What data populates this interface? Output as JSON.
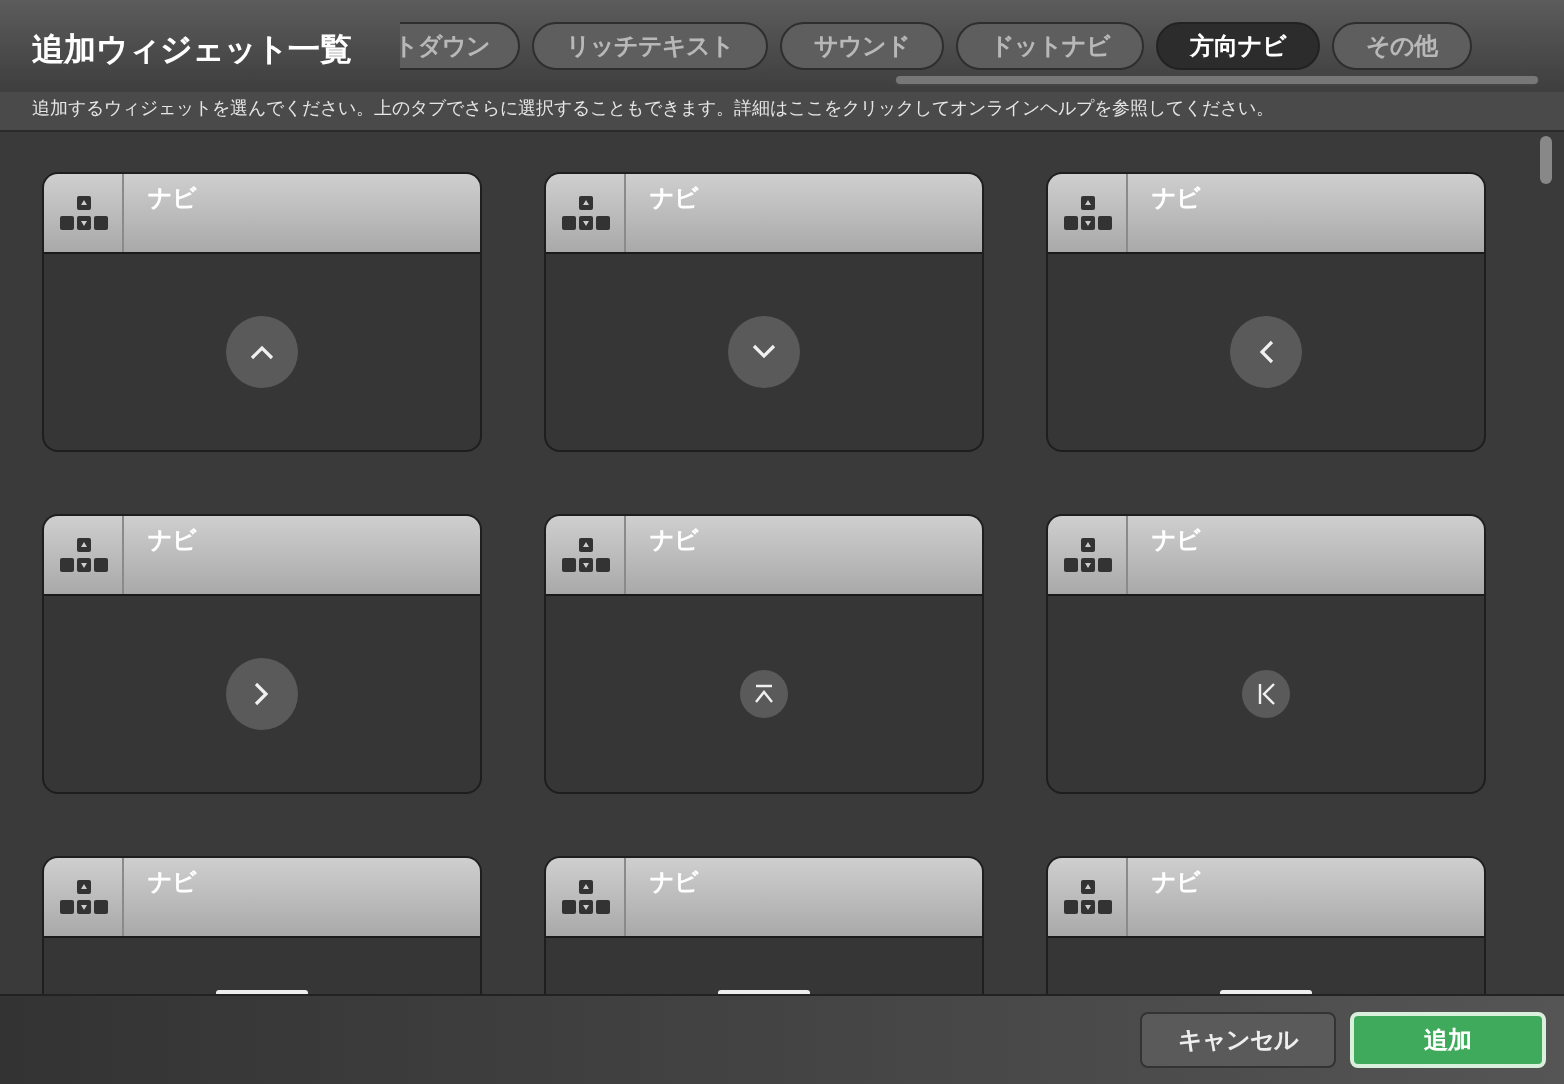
{
  "window": {
    "title": "追加ウィジェット一覧"
  },
  "tabs": [
    {
      "label": "トダウン",
      "selected": false,
      "clipped": true
    },
    {
      "label": "リッチテキスト",
      "selected": false
    },
    {
      "label": "サウンド",
      "selected": false
    },
    {
      "label": "ドットナビ",
      "selected": false
    },
    {
      "label": "方向ナビ",
      "selected": true
    },
    {
      "label": "その他",
      "selected": false
    }
  ],
  "hint": "追加するウィジェットを選んでください。上のタブでさらに選択することもできます。詳細はここをクリックしてオンラインヘルプを参照してください。",
  "widgets": [
    {
      "label": "ナビ",
      "kind": "up"
    },
    {
      "label": "ナビ",
      "kind": "down"
    },
    {
      "label": "ナビ",
      "kind": "left"
    },
    {
      "label": "ナビ",
      "kind": "right"
    },
    {
      "label": "ナビ",
      "kind": "top"
    },
    {
      "label": "ナビ",
      "kind": "first"
    },
    {
      "label": "ナビ",
      "kind": "cut"
    },
    {
      "label": "ナビ",
      "kind": "cut"
    },
    {
      "label": "ナビ",
      "kind": "cut"
    }
  ],
  "buttons": [
    {
      "label": "キャンセル",
      "kind": "secondary"
    },
    {
      "label": "追加",
      "kind": "primary"
    }
  ]
}
